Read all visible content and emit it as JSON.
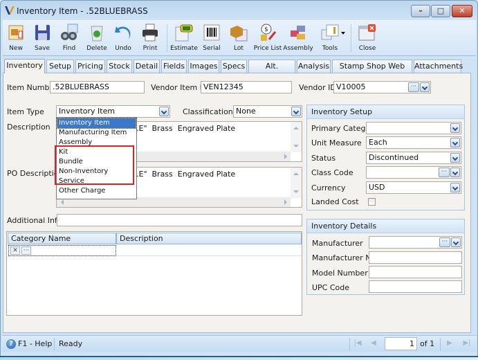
{
  "window": {
    "title": "Inventory Item - .52BLUEBRASS",
    "controls": {
      "minimize": "–",
      "maximize": "□",
      "close": "✕"
    }
  },
  "toolbar": {
    "buttons": [
      {
        "label": "New",
        "icon": "new-item-icon"
      },
      {
        "label": "Save",
        "icon": "floppy-disk-icon"
      },
      {
        "label": "Find",
        "icon": "binoculars-icon"
      },
      {
        "label": "Delete",
        "icon": "recycle-bin-icon"
      },
      {
        "label": "Undo",
        "icon": "undo-arrow-icon"
      },
      {
        "label": "Print",
        "icon": "printer-icon"
      },
      {
        "label": "Estimate",
        "icon": "estimate-icon"
      },
      {
        "label": "Serial",
        "icon": "barcode-icon"
      },
      {
        "label": "Lot",
        "icon": "lot-box-icon"
      },
      {
        "label": "Price List",
        "icon": "price-list-icon"
      },
      {
        "label": "Assembly",
        "icon": "assembly-blocks-icon"
      },
      {
        "label": "Tools",
        "icon": "tools-icon"
      },
      {
        "label": "Close",
        "icon": "close-window-icon"
      }
    ]
  },
  "tabs": [
    {
      "label": "Inventory",
      "active": true
    },
    {
      "label": "Setup"
    },
    {
      "label": "Pricing"
    },
    {
      "label": "Stock"
    },
    {
      "label": "Detail"
    },
    {
      "label": "Fields"
    },
    {
      "label": "Images"
    },
    {
      "label": "Specs"
    },
    {
      "label": "Alt. Vendors"
    },
    {
      "label": "Analysis"
    },
    {
      "label": "Stamp Shop Web Detail"
    },
    {
      "label": "Attachments"
    }
  ],
  "form": {
    "item_number": {
      "label": "Item Number",
      "value": ".52BLUEBRASS"
    },
    "vendor_item_no": {
      "label": "Vendor Item No",
      "value": "VEN12345"
    },
    "vendor_id": {
      "label": "Vendor ID",
      "value": "V10005"
    },
    "item_type": {
      "label": "Item Type",
      "value": "Inventory Item",
      "options": [
        "Inventory Item",
        "Manufacturing Item",
        "Assembly",
        "Kit",
        "Bundle",
        "Non-Inventory",
        "Service",
        "Other Charge"
      ],
      "highlighted_options": [
        "Kit",
        "Bundle",
        "Non-Inventory",
        "Service"
      ]
    },
    "classification": {
      "label": "Classification",
      "value": "None"
    },
    "description": {
      "label": "Description",
      "value": ".E\"  Brass  Engraved Plate"
    },
    "po_description": {
      "label": "PO Description",
      "value": ".E\"  Brass  Engraved Plate"
    },
    "additional_info": {
      "label": "Additional Info",
      "value": ""
    }
  },
  "category_grid": {
    "columns": [
      "Category Name",
      "Description"
    ],
    "row_buttons": {
      "clear": "✕",
      "browse": "···"
    }
  },
  "inventory_setup": {
    "title": "Inventory Setup",
    "fields": [
      {
        "label": "Primary Category",
        "value": ""
      },
      {
        "label": "Unit Measure",
        "value": "Each"
      },
      {
        "label": "Status",
        "value": "Discontinued"
      },
      {
        "label": "Class Code",
        "value": ""
      },
      {
        "label": "Currency",
        "value": "USD"
      }
    ],
    "landed_cost": {
      "label": "Landed Cost",
      "checked": false
    }
  },
  "inventory_details": {
    "title": "Inventory Details",
    "fields": [
      {
        "label": "Manufacturer",
        "value": ""
      },
      {
        "label": "Manufacturer No",
        "value": ""
      },
      {
        "label": "Model Number",
        "value": ""
      },
      {
        "label": "UPC Code",
        "value": ""
      }
    ]
  },
  "statusbar": {
    "help": "F1 - Help",
    "status": "Ready",
    "page": "1",
    "of_label": "of 1"
  },
  "colors": {
    "selection": "#3b78cb",
    "highlight_box": "#e01e24",
    "title_bar": "#bcd6ee",
    "close_button": "#c1412a"
  }
}
